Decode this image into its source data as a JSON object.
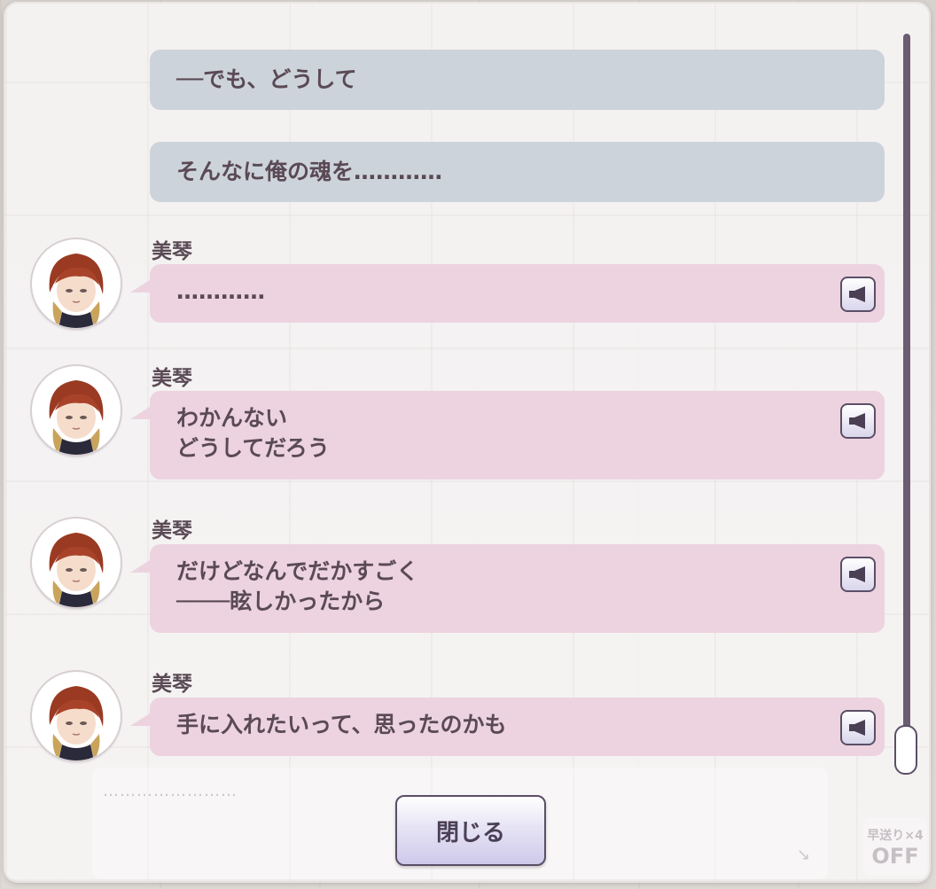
{
  "log": {
    "narrations": [
      {
        "text": "──でも、どうして"
      },
      {
        "text": "そんなに俺の魂を…………"
      }
    ],
    "speeches": [
      {
        "speaker": "美琴",
        "lines": [
          "…………"
        ]
      },
      {
        "speaker": "美琴",
        "lines": [
          "わかんない",
          "どうしてだろう"
        ]
      },
      {
        "speaker": "美琴",
        "lines": [
          "だけどなんでだかすごく",
          "────眩しかったから"
        ]
      },
      {
        "speaker": "美琴",
        "lines": [
          "手に入れたいって、思ったのかも"
        ]
      }
    ]
  },
  "controls": {
    "close_label": "閉じる",
    "skip_label": "早送り×4",
    "skip_state": "OFF",
    "ghost_text": "……………………"
  },
  "icons": {
    "voice": "speaker-icon",
    "avatar": "character-portrait"
  },
  "colors": {
    "narration_bg": "#cdd3da",
    "speech_bg": "#ecd3df",
    "text": "#5a4a55",
    "button_border": "#5b4f66"
  }
}
